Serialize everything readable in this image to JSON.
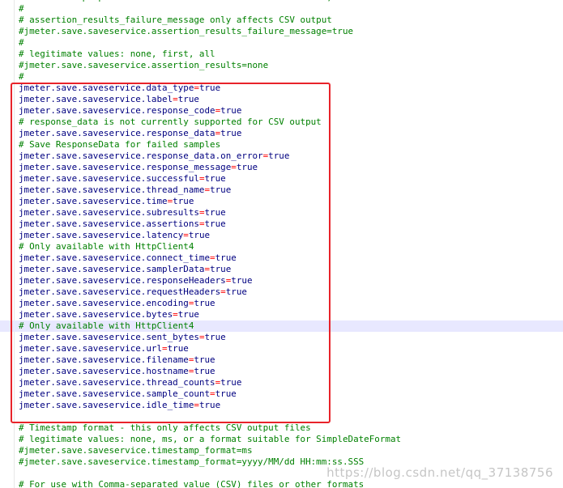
{
  "lines": [
    {
      "t": "c",
      "text": "# The below properties are true when field should be saved; false otherwise"
    },
    {
      "t": "c",
      "text": "#"
    },
    {
      "t": "c",
      "text": "# assertion_results_failure_message only affects CSV output"
    },
    {
      "t": "c",
      "text": "#jmeter.save.saveservice.assertion_results_failure_message=true"
    },
    {
      "t": "c",
      "text": "#"
    },
    {
      "t": "c",
      "text": "# legitimate values: none, first, all"
    },
    {
      "t": "c",
      "text": "#jmeter.save.saveservice.assertion_results=none"
    },
    {
      "t": "c",
      "text": "#"
    },
    {
      "t": "p",
      "key": "jmeter.save.saveservice.data_type",
      "value": "true"
    },
    {
      "t": "p",
      "key": "jmeter.save.saveservice.label",
      "value": "true"
    },
    {
      "t": "p",
      "key": "jmeter.save.saveservice.response_code",
      "value": "true"
    },
    {
      "t": "c",
      "text": "# response_data is not currently supported for CSV output"
    },
    {
      "t": "p",
      "key": "jmeter.save.saveservice.response_data",
      "value": "true"
    },
    {
      "t": "c",
      "text": "# Save ResponseData for failed samples"
    },
    {
      "t": "p",
      "key": "jmeter.save.saveservice.response_data.on_error",
      "value": "true"
    },
    {
      "t": "p",
      "key": "jmeter.save.saveservice.response_message",
      "value": "true"
    },
    {
      "t": "p",
      "key": "jmeter.save.saveservice.successful",
      "value": "true"
    },
    {
      "t": "p",
      "key": "jmeter.save.saveservice.thread_name",
      "value": "true"
    },
    {
      "t": "p",
      "key": "jmeter.save.saveservice.time",
      "value": "true"
    },
    {
      "t": "p",
      "key": "jmeter.save.saveservice.subresults",
      "value": "true"
    },
    {
      "t": "p",
      "key": "jmeter.save.saveservice.assertions",
      "value": "true"
    },
    {
      "t": "p",
      "key": "jmeter.save.saveservice.latency",
      "value": "true"
    },
    {
      "t": "c",
      "text": "# Only available with HttpClient4"
    },
    {
      "t": "p",
      "key": "jmeter.save.saveservice.connect_time",
      "value": "true"
    },
    {
      "t": "p",
      "key": "jmeter.save.saveservice.samplerData",
      "value": "true"
    },
    {
      "t": "p",
      "key": "jmeter.save.saveservice.responseHeaders",
      "value": "true"
    },
    {
      "t": "p",
      "key": "jmeter.save.saveservice.requestHeaders",
      "value": "true"
    },
    {
      "t": "p",
      "key": "jmeter.save.saveservice.encoding",
      "value": "true"
    },
    {
      "t": "p",
      "key": "jmeter.save.saveservice.bytes",
      "value": "true"
    },
    {
      "t": "c",
      "text": "# Only available with HttpClient4",
      "current": true
    },
    {
      "t": "p",
      "key": "jmeter.save.saveservice.sent_bytes",
      "value": "true"
    },
    {
      "t": "p",
      "key": "jmeter.save.saveservice.url",
      "value": "true"
    },
    {
      "t": "p",
      "key": "jmeter.save.saveservice.filename",
      "value": "true"
    },
    {
      "t": "p",
      "key": "jmeter.save.saveservice.hostname",
      "value": "true"
    },
    {
      "t": "p",
      "key": "jmeter.save.saveservice.thread_counts",
      "value": "true"
    },
    {
      "t": "p",
      "key": "jmeter.save.saveservice.sample_count",
      "value": "true"
    },
    {
      "t": "p",
      "key": "jmeter.save.saveservice.idle_time",
      "value": "true"
    },
    {
      "t": "c",
      "text": ""
    },
    {
      "t": "c",
      "text": "# Timestamp format - this only affects CSV output files"
    },
    {
      "t": "c",
      "text": "# legitimate values: none, ms, or a format suitable for SimpleDateFormat"
    },
    {
      "t": "c",
      "text": "#jmeter.save.saveservice.timestamp_format=ms"
    },
    {
      "t": "c",
      "text": "#jmeter.save.saveservice.timestamp_format=yyyy/MM/dd HH:mm:ss.SSS"
    },
    {
      "t": "c",
      "text": ""
    },
    {
      "t": "c",
      "text": "# For use with Comma-separated value (CSV) files or other formats"
    }
  ],
  "watermark": "https://blog.csdn.net/qq_37138756",
  "colors": {
    "comment": "#008000",
    "key": "#000080",
    "operator": "#ff0000",
    "highlight_box": "#e8232a",
    "current_line": "#e8e8ff"
  }
}
